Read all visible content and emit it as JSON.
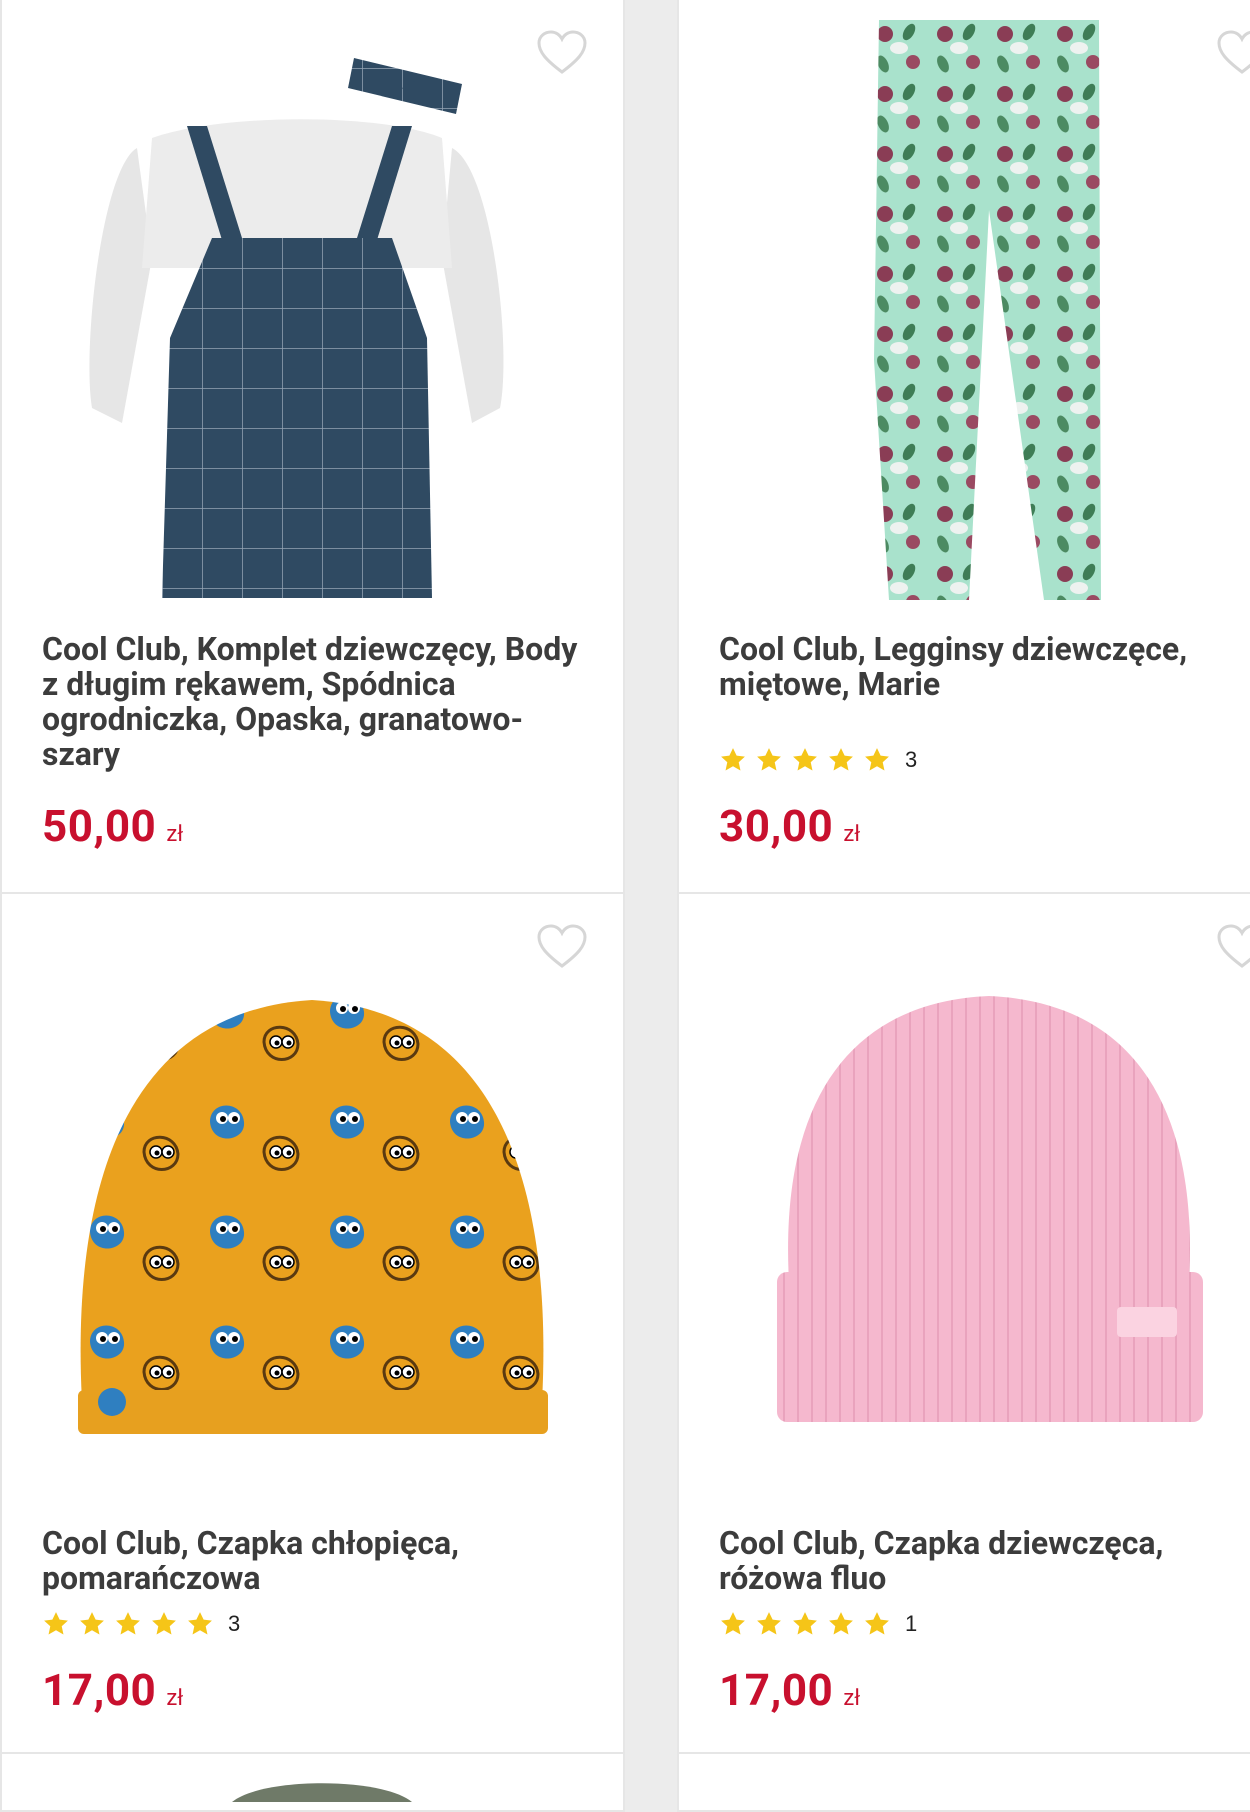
{
  "colors": {
    "price": "#c8102e",
    "star": "#f5c518",
    "title": "#3c3c3c",
    "heart": "#d6d6d6"
  },
  "products": [
    {
      "title": "Cool Club, Komplet dziewczęcy, Body z długim rękawem, Spódnica ogrodniczka, Opaska, granatowo-szary",
      "price": "50,00",
      "currency": "zł",
      "rating_count": null,
      "icons": [
        "heart-icon"
      ]
    },
    {
      "title": "Cool Club, Legginsy dziewczęce, miętowe, Marie",
      "price": "30,00",
      "currency": "zł",
      "rating_count": "3",
      "icons": [
        "heart-icon",
        "star-icon"
      ]
    },
    {
      "title": "Cool Club, Czapka chłopięca, pomarańczowa",
      "price": "17,00",
      "currency": "zł",
      "rating_count": "3",
      "icons": [
        "heart-icon",
        "star-icon"
      ]
    },
    {
      "title": "Cool Club, Czapka dziewczęca, różowa fluo",
      "price": "17,00",
      "currency": "zł",
      "rating_count": "1",
      "icons": [
        "heart-icon",
        "star-icon"
      ]
    }
  ]
}
